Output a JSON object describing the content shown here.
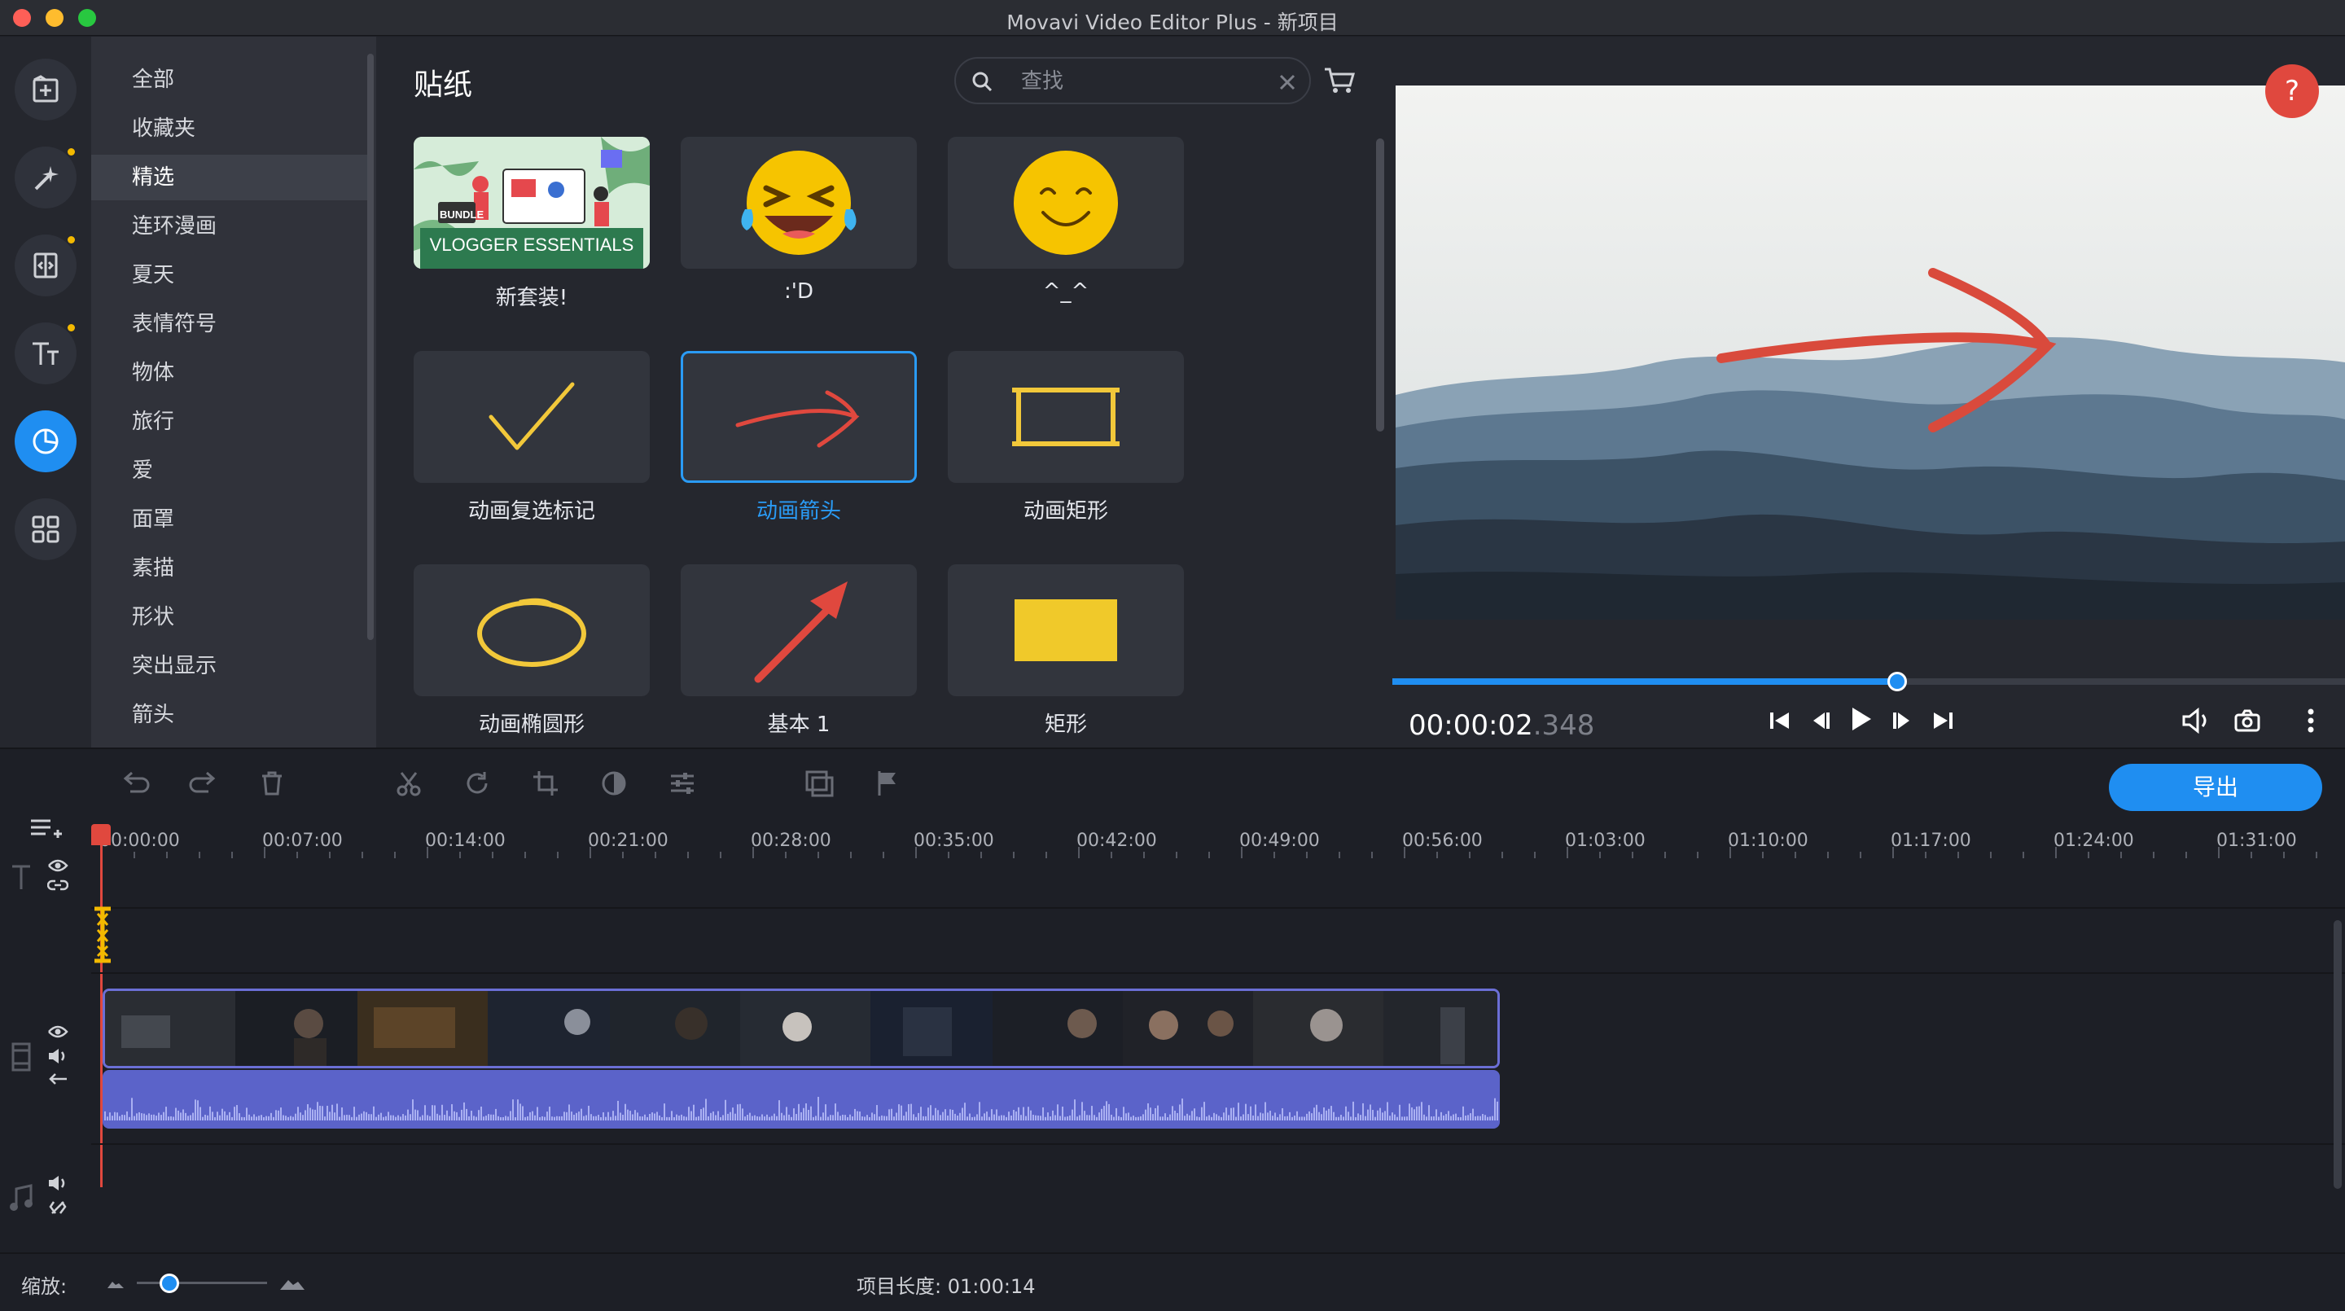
{
  "window": {
    "title": "Movavi Video Editor Plus - 新项目"
  },
  "categories": [
    "全部",
    "收藏夹",
    "精选",
    "连环漫画",
    "夏天",
    "表情符号",
    "物体",
    "旅行",
    "爱",
    "面罩",
    "素描",
    "形状",
    "突出显示",
    "箭头"
  ],
  "selected_category": "精选",
  "stickers": {
    "title": "贴纸",
    "search_placeholder": "查找",
    "bundle_badge": "BUNDLE",
    "bundle_title": "VLOGGER ESSENTIALS",
    "items": [
      {
        "label": "新套装!"
      },
      {
        "label": ":'D"
      },
      {
        "label": "^_^"
      },
      {
        "label": "动画复选标记"
      },
      {
        "label": "动画箭头"
      },
      {
        "label": "动画矩形"
      },
      {
        "label": "动画椭圆形"
      },
      {
        "label": "基本 1"
      },
      {
        "label": "矩形"
      }
    ]
  },
  "player": {
    "time_main": "00:00:02",
    "time_ms": ".348",
    "progress": 0.53,
    "help": "?"
  },
  "timeline": {
    "export_label": "导出",
    "ticks": [
      "00:00:00",
      "00:07:00",
      "00:14:00",
      "00:21:00",
      "00:28:00",
      "00:35:00",
      "00:42:00",
      "00:49:00",
      "00:56:00",
      "01:03:00",
      "01:10:00",
      "01:17:00",
      "01:24:00",
      "01:31:00"
    ],
    "zoom_label": "缩放:",
    "project_length_label": "项目长度:",
    "project_length": "01:00:14"
  },
  "colors": {
    "accent": "#1f8ef1",
    "warning": "#f3b900",
    "help": "#e0483e",
    "clip_border": "#6b6fd6",
    "audio": "#5b63c9"
  }
}
